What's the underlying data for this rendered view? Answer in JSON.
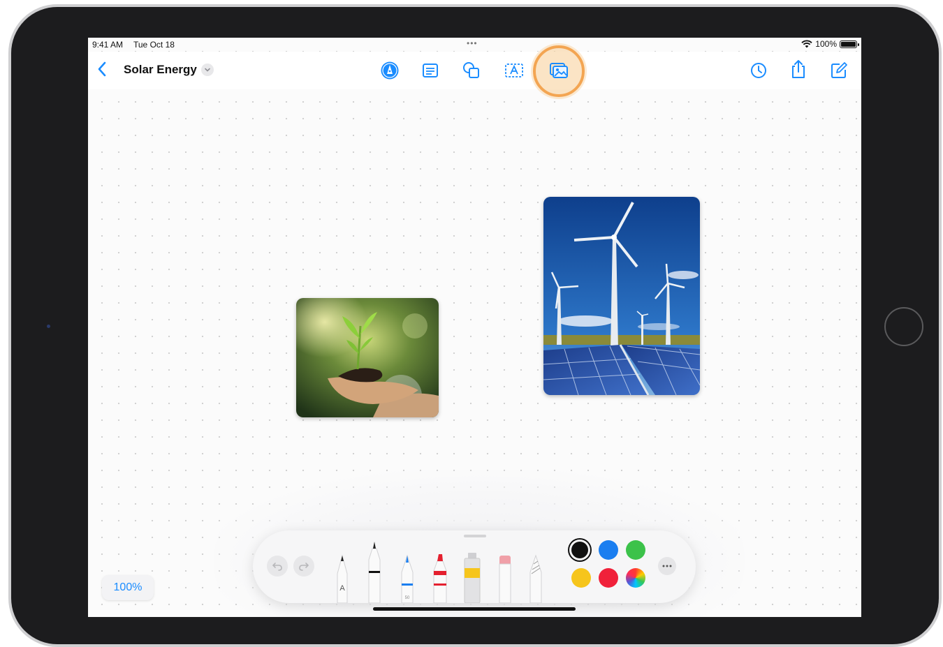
{
  "status_bar": {
    "time": "9:41 AM",
    "date": "Tue Oct 18",
    "multitask": "•••",
    "battery": "100%"
  },
  "toolbar": {
    "back_icon": "chevron-left-icon",
    "title": "Solar Energy",
    "title_menu_icon": "chevron-down-icon",
    "center_tools": [
      "pen-tip-icon",
      "note-icon",
      "shapes-icon",
      "text-box-icon",
      "media-icon"
    ],
    "highlighted_tool": "media-icon",
    "right_tools": [
      "history-icon",
      "share-icon",
      "compose-icon"
    ]
  },
  "canvas": {
    "images": [
      "plant-in-hands-photo",
      "wind-turbines-solar-panels-photo"
    ]
  },
  "zoom": {
    "label": "100%"
  },
  "palette": {
    "tools": [
      "monoline-pen",
      "fountain-pen",
      "ballpoint-pen",
      "marker",
      "watercolor",
      "eraser",
      "pencil"
    ],
    "colors": [
      "#111111",
      "#1a7ef0",
      "#3cc24a",
      "#f6c51c",
      "#f0213a",
      "multicolor"
    ],
    "selected_color": "#111111",
    "pen_label": "A",
    "pen_size_label": "50"
  },
  "colors": {
    "accent": "#1a8cff",
    "highlight": "#f3a552"
  }
}
